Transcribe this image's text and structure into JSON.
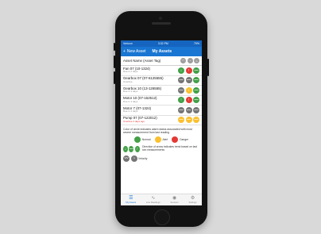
{
  "status": {
    "carrier": "Verizon",
    "time": "3:32 PM",
    "battery": "79%"
  },
  "topnav": {
    "new_asset": "New Asset",
    "title": "My Assets"
  },
  "table": {
    "header": "Asset Name (Asset Tag)"
  },
  "assets": [
    {
      "name": "Fan 07 (10-1324)",
      "due": "Due in 1 days",
      "overdue": false,
      "alarms": [
        "green-down",
        "red-up",
        "green-flat"
      ]
    },
    {
      "name": "Gearbox 07 (07-6125555)",
      "due": "Overdue",
      "overdue": false,
      "alarms": [
        "gray-flat",
        "gray-flat",
        "green-flat"
      ]
    },
    {
      "name": "Gearbox 10 (13-126555)",
      "due": "Due in 1 days",
      "overdue": false,
      "alarms": [
        "gray-flat",
        "yellow-down",
        "green-flat"
      ]
    },
    {
      "name": "Motor 10 (07-152512)",
      "due": "Due in 1 days",
      "overdue": false,
      "alarms": [
        "green-up",
        "red-up",
        "green-flat"
      ]
    },
    {
      "name": "Motor 7 (07-1324)",
      "due": "Due in 1 days",
      "overdue": false,
      "alarms": [
        "gray-flat",
        "gray-flat",
        "gray-flat"
      ]
    },
    {
      "name": "Pump 07 (07-122012)",
      "due": "Overdue 4 days ago",
      "overdue": true,
      "alarms": [
        "yellow-flat",
        "yellow-flat",
        "yellow-flat"
      ]
    }
  ],
  "legend": {
    "intro": "Color of circle indicates alarm status associated with most severe measurement from last reading",
    "normal": "Normal",
    "alert": "Alert",
    "danger": "Danger",
    "direction": "Direction of arrow indicates trend based on last two measurements",
    "velocity": "Velocity"
  },
  "colors": {
    "green": "#43a047",
    "yellow": "#fbc02d",
    "red": "#e53935",
    "gray": "#757575",
    "brand": "#1976d2"
  },
  "tabs": [
    "My Assets",
    "Live Readings",
    "Sensors",
    "Settings"
  ]
}
